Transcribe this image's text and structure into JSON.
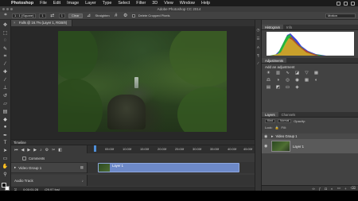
{
  "menubar": {
    "apple": "",
    "items": [
      "Photoshop",
      "File",
      "Edit",
      "Image",
      "Layer",
      "Type",
      "Select",
      "Filter",
      "3D",
      "View",
      "Window",
      "Help"
    ]
  },
  "window": {
    "title": "Adobe Photoshop CC 2014"
  },
  "options": {
    "ratio": "1 : 1 (Square)",
    "width": "1",
    "height": "1",
    "clear_label": "Clear",
    "straighten_label": "Straighten",
    "delete_cropped_label": "Delete Cropped Pixels",
    "workspace": "Motion"
  },
  "document": {
    "tab_label": "Falls @ 16.7% (Layer 1, RGB/8)",
    "close_glyph": "×"
  },
  "status": {
    "zoom": "16.67%",
    "doc_size": "Doc: 23.7M/23.7M"
  },
  "timeline": {
    "header": "Timeline",
    "ruler": [
      "05:00f",
      "10:00f",
      "15:00f",
      "20:00f",
      "25:00f",
      "30:00f",
      "35:00f",
      "40:00f",
      "45:00f"
    ],
    "comments_label": "Comments",
    "video_group_label": "Video Group 1",
    "audio_track_label": "Audio Track",
    "clip_label": "Layer 1",
    "timecode": "0;00;01;28",
    "fps": "(29.97 fps)"
  },
  "panels": {
    "histogram_tab": "Histogram",
    "info_tab": "Info",
    "adjustments_tab": "Adjustments",
    "add_adjustment": "Add an adjustment",
    "layers_tab": "Layers",
    "channels_tab": "Channels",
    "kind_label": "Kind",
    "blend_mode": "Normal",
    "opacity_label": "Opacity:",
    "lock_label": "Lock:",
    "fill_label": "Fill:",
    "layer_group_name": "Video Group 1",
    "layer_name": "Layer 1"
  },
  "colors": {
    "clip": "#6d89c8",
    "playhead": "#4f8fd8",
    "panel_bg": "#424242",
    "canvas_green": "#2f4a23"
  }
}
